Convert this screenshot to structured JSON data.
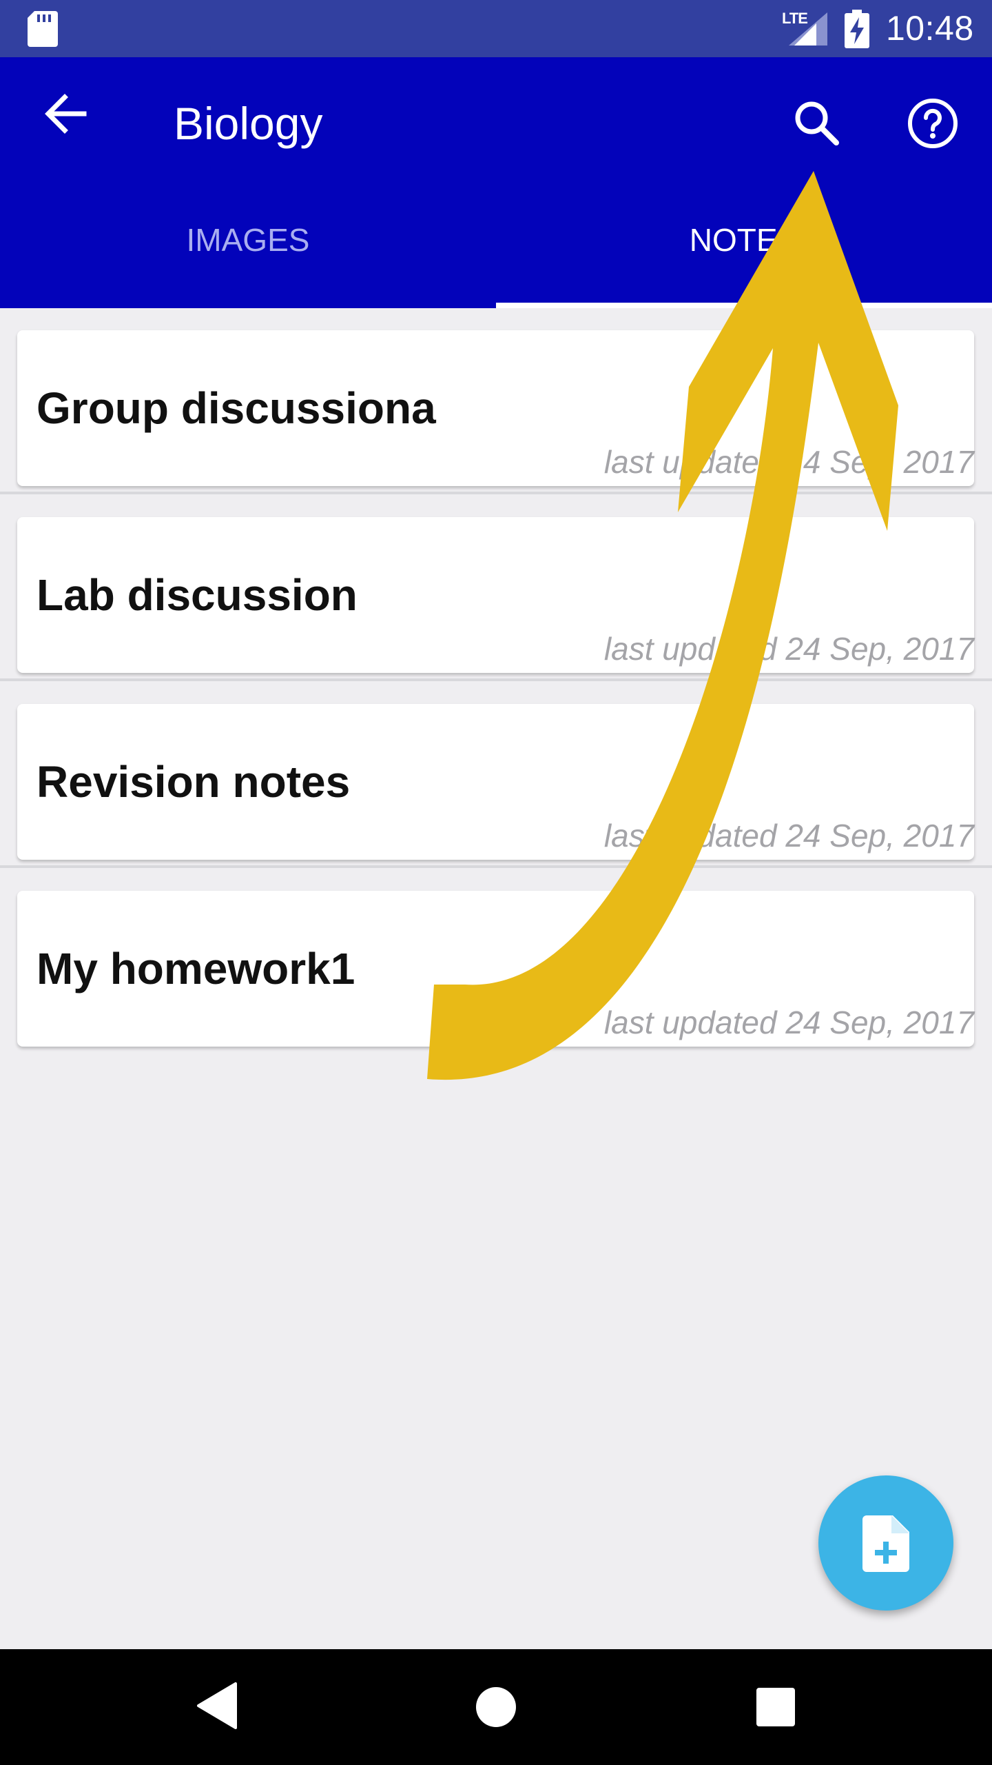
{
  "status_bar": {
    "network_label": "LTE",
    "time": "10:48",
    "icons": [
      "sd-card-icon",
      "signal-icon",
      "battery-charging-icon"
    ]
  },
  "app_bar": {
    "title": "Biology",
    "icons": [
      "back-arrow-icon",
      "search-icon",
      "help-icon"
    ],
    "background": "#0303BA"
  },
  "tabs": [
    {
      "label": "IMAGES",
      "selected": false
    },
    {
      "label": "NOTES",
      "selected": true
    }
  ],
  "notes": [
    {
      "title": "Group discussiona",
      "updated": "last updated 24 Sep, 2017"
    },
    {
      "title": "Lab discussion",
      "updated": "last updated 24 Sep, 2017"
    },
    {
      "title": "Revision notes",
      "updated": "last updated 24 Sep, 2017"
    },
    {
      "title": "My homework1",
      "updated": "last updated 24 Sep, 2017"
    }
  ],
  "fab": {
    "icon": "add-note-icon",
    "color": "#3CB4E6"
  },
  "nav_bar": {
    "icons": [
      "nav-back-icon",
      "nav-home-icon",
      "nav-recents-icon"
    ]
  },
  "overlay": {
    "icon": "annotation-arrow",
    "color": "#E8BA17"
  }
}
